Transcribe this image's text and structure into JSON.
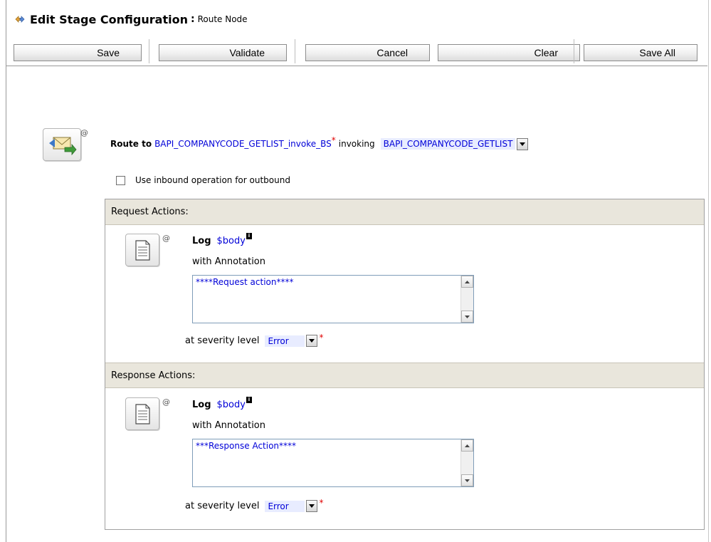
{
  "header": {
    "title": "Edit Stage Configuration",
    "separator": ":",
    "subtitle": "Route Node"
  },
  "toolbar": {
    "save_label": "Save",
    "validate_label": "Validate",
    "cancel_label": "Cancel",
    "clear_label": "Clear",
    "save_all_label": "Save All"
  },
  "route": {
    "at_mark": "@",
    "route_to_label": "Route to",
    "service_link": "BAPI_COMPANYCODE_GETLIST_invoke_BS",
    "required_mark": "*",
    "invoking_label": "invoking",
    "operation_value": "BAPI_COMPANYCODE_GETLIST",
    "use_inbound_label": "Use inbound operation for outbound",
    "use_inbound_checked": false
  },
  "request_actions": {
    "header": "Request Actions:",
    "at_mark": "@",
    "log_label": "Log",
    "log_var": "$body",
    "info_badge": "i",
    "with_annotation_label": "with Annotation",
    "annotation_value": "****Request action****",
    "severity_label": "at severity level",
    "severity_value": "Error",
    "required_mark": "*"
  },
  "response_actions": {
    "header": "Response Actions:",
    "at_mark": "@",
    "log_label": "Log",
    "log_var": "$body",
    "info_badge": "i",
    "with_annotation_label": "with Annotation",
    "annotation_value": "***Response Action****",
    "severity_label": "at severity level",
    "severity_value": "Error",
    "required_mark": "*"
  },
  "colors": {
    "link": "#0000d8",
    "required": "#e00000",
    "section_header_bg": "#e9e6dc",
    "select_bg": "#e8ecff"
  },
  "icons": {
    "title": "stage-config-icon",
    "route_node": "route-envelope-icon",
    "log_action": "log-document-icon"
  }
}
